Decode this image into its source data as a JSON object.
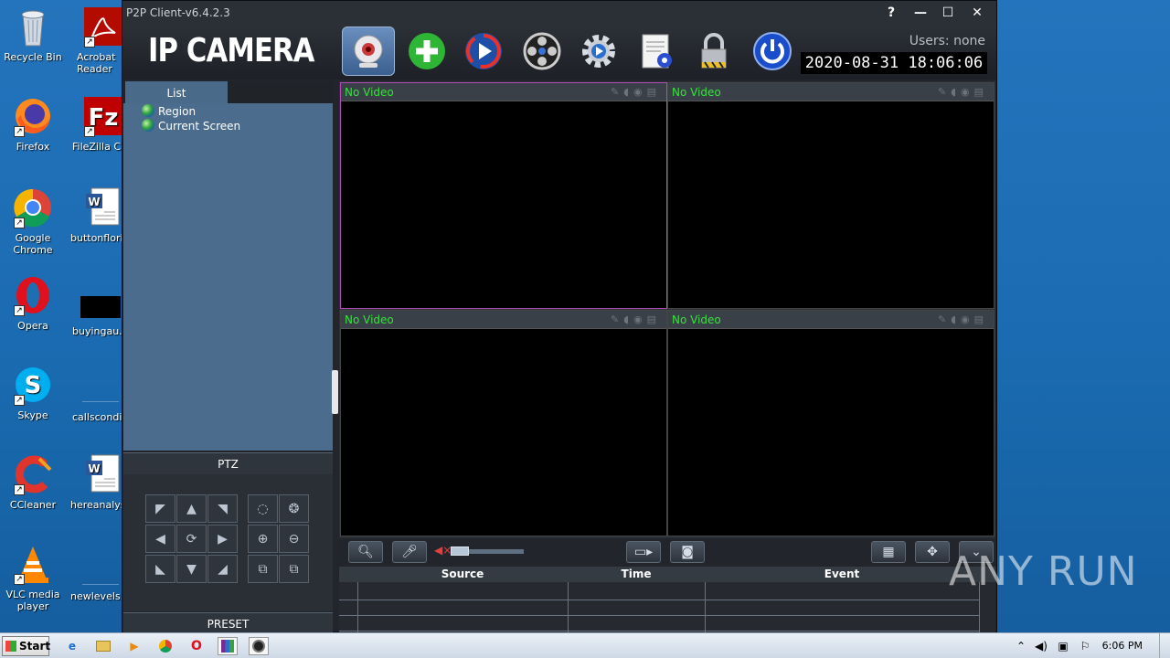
{
  "desktop_icons": [
    {
      "label": "Recycle Bin",
      "icon": "recycle-bin-icon"
    },
    {
      "label": "Firefox",
      "icon": "firefox-icon"
    },
    {
      "label": "Google Chrome",
      "icon": "chrome-icon"
    },
    {
      "label": "Opera",
      "icon": "opera-icon"
    },
    {
      "label": "Skype",
      "icon": "skype-icon"
    },
    {
      "label": "CCleaner",
      "icon": "ccleaner-icon"
    },
    {
      "label": "VLC media player",
      "icon": "vlc-icon"
    },
    {
      "label": "Acrobat Reader DC",
      "icon": "acrobat-icon"
    },
    {
      "label": "FileZilla Client",
      "icon": "filezilla-icon"
    },
    {
      "label": "buttonflorida.rtf",
      "icon": "word-doc-icon"
    },
    {
      "label": "buyingau.jpg",
      "icon": "image-icon"
    },
    {
      "label": "callscondition",
      "icon": "file-icon"
    },
    {
      "label": "hereanalysis.rtf",
      "icon": "word-doc-icon"
    },
    {
      "label": "newlevels.png",
      "icon": "image-icon"
    }
  ],
  "window": {
    "title": "P2P Client-v6.4.2.3",
    "help": "?",
    "minimize": "—",
    "maximize": "☐",
    "close": "✕"
  },
  "toolbar": {
    "logo": "IP CAMERA",
    "users": "Users: none",
    "clock": "2020-08-31  18:06:06",
    "tools": [
      "camera-icon",
      "add-icon",
      "playback-icon",
      "film-reel-icon",
      "settings-gear-icon",
      "document-log-icon",
      "lock-icon",
      "power-icon"
    ]
  },
  "left_panel": {
    "list_tab": "List",
    "tree": [
      "Region",
      "Current Screen"
    ],
    "ptz_header": "PTZ",
    "preset_header": "PRESET"
  },
  "video": {
    "cells": [
      "No Video",
      "No Video",
      "No Video",
      "No Video"
    ]
  },
  "event_log": {
    "columns": [
      "Source",
      "Time",
      "Event"
    ]
  },
  "taskbar": {
    "start": "Start",
    "time": "6:06 PM"
  },
  "watermark": "ANY RUN",
  "colors": {
    "desktop": "#1d6fb2",
    "no_video_text": "#36e23a",
    "selected_cell_border": "#b24bb8",
    "app_bg": "#22262c"
  }
}
